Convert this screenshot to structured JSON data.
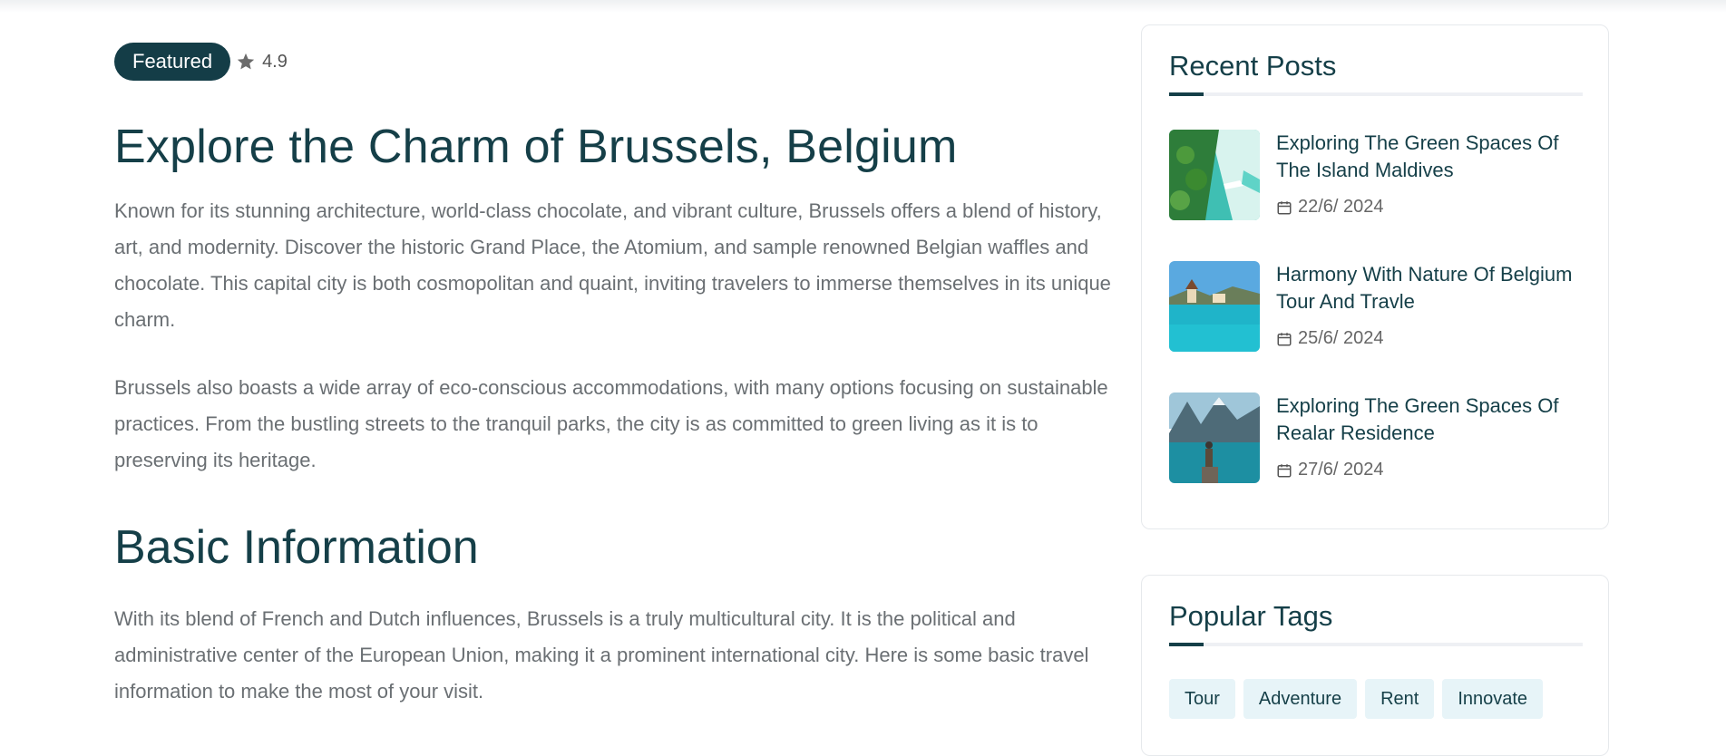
{
  "article": {
    "badge": "Featured",
    "rating": "4.9",
    "title": "Explore the Charm of Brussels, Belgium",
    "paragraph1": "Known for its stunning architecture, world-class chocolate, and vibrant culture, Brussels offers a blend of history, art, and modernity. Discover the historic Grand Place, the Atomium, and sample renowned Belgian waffles and chocolate. This capital city is both cosmopolitan and quaint, inviting travelers to immerse themselves in its unique charm.",
    "paragraph2": "Brussels also boasts a wide array of eco-conscious accommodations, with many options focusing on sustainable practices. From the bustling streets to the tranquil parks, the city is as committed to green living as it is to preserving its heritage.",
    "section_title": "Basic Information",
    "paragraph3": "With its blend of French and Dutch influences, Brussels is a truly multicultural city. It is the political and administrative center of the European Union, making it a prominent international city. Here is some basic travel information to make the most of your visit."
  },
  "sidebar": {
    "recent_posts": {
      "title": "Recent Posts",
      "posts": [
        {
          "title": "Exploring The Green Spaces Of The Island Maldives",
          "date": "22/6/ 2024"
        },
        {
          "title": "Harmony With Nature Of Belgium Tour And Travle",
          "date": "25/6/ 2024"
        },
        {
          "title": "Exploring The Green Spaces Of Realar Residence",
          "date": "27/6/ 2024"
        }
      ]
    },
    "popular_tags": {
      "title": "Popular Tags",
      "tags": [
        "Tour",
        "Adventure",
        "Rent",
        "Innovate"
      ]
    }
  },
  "icons": {
    "rating": "star-icon",
    "date": "calendar-icon"
  },
  "colors": {
    "primary": "#153f48",
    "tag_bg": "#e7f4f8",
    "body_text": "#6a6f73"
  }
}
